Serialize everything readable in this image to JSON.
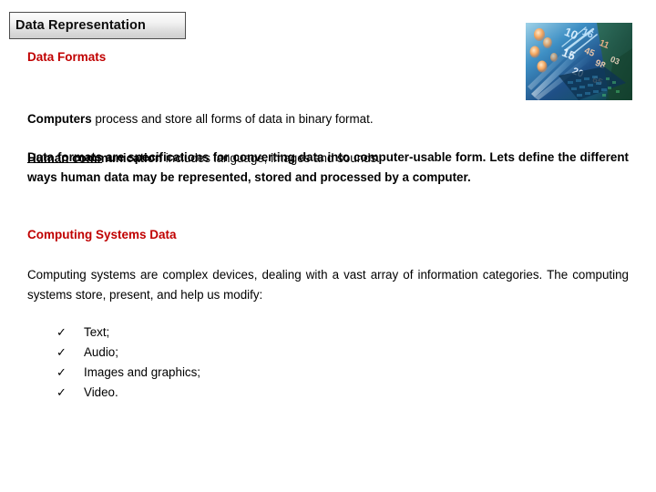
{
  "slide": {
    "title": "Data Representation",
    "background_color": "#FFFFFF",
    "accent_color": "#C00000"
  },
  "headings": {
    "data_formats": "Data Formats",
    "computing_systems_data": "Computing Systems Data"
  },
  "paragraphs": {
    "intro_line1_bold": "Computers",
    "intro_line1_rest": " process and store all forms of data in binary format.",
    "intro_line2_bold": "Human communication",
    "intro_line2_rest": " includes language, images and sounds.",
    "data_formats_underlined": "Data formats",
    "data_formats_rest": " are specifications for converting data into computer-usable form. Lets define the different ways human data may be represented, stored and processed by a computer.",
    "computing_systems": "Computing systems are complex devices, dealing with a vast array of information categories. The computing systems store, present, and help us modify:"
  },
  "checklist": {
    "bullet_glyph": "✓",
    "items": [
      "Text;",
      "Audio;",
      "Images and graphics;",
      "Video."
    ]
  },
  "thumbnail": {
    "alt": "abstract digital technology image with binary numbers and blue light streaks",
    "numbers": [
      "10",
      "15",
      "16",
      "11",
      "45",
      "98",
      "65",
      "03",
      "20"
    ]
  }
}
